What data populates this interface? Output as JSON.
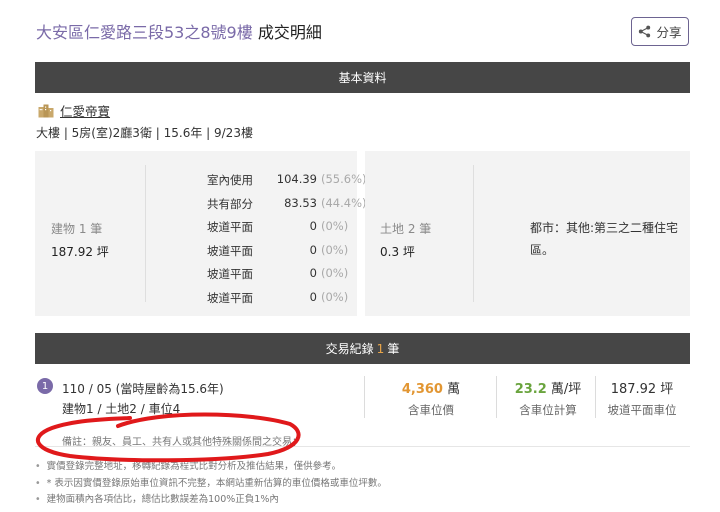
{
  "page": {
    "title_address": "大安區仁愛路三段53之8號9樓",
    "title_suffix": "成交明細",
    "share_label": "分享"
  },
  "basic": {
    "header": "基本資料",
    "community_name": "仁愛帝寶",
    "summary": "大樓 | 5房(室)2廳3衛 | 15.6年 | 9/23樓",
    "building": {
      "label": "建物 1 筆",
      "total": "187.92 坪",
      "rows": [
        {
          "label": "室內使用",
          "value": "104.39",
          "pct": "(55.6%)"
        },
        {
          "label": "共有部分",
          "value": "83.53",
          "pct": "(44.4%)"
        },
        {
          "label": "坡道平面",
          "value": "0",
          "pct": "(0%)"
        },
        {
          "label": "坡道平面",
          "value": "0",
          "pct": "(0%)"
        },
        {
          "label": "坡道平面",
          "value": "0",
          "pct": "(0%)"
        },
        {
          "label": "坡道平面",
          "value": "0",
          "pct": "(0%)"
        }
      ]
    },
    "land": {
      "label": "土地 2 筆",
      "total": "0.3 坪",
      "zoning": "都市：其他:第三之二種住宅區。"
    }
  },
  "transactions": {
    "header_prefix": "交易紀錄",
    "count": "1",
    "header_suffix": "筆",
    "records": [
      {
        "index": "1",
        "date": "110 / 05 (當時屋齡為15.6年)",
        "parts": "建物1 / 土地2 / 車位4",
        "price_value": "4,360",
        "price_unit": "萬",
        "price_caption": "含車位價",
        "unit_price_value": "23.2",
        "unit_price_unit": "萬/坪",
        "unit_price_caption": "含車位計算",
        "parking_area": "187.92 坪",
        "parking_caption": "坡道平面車位",
        "remark": "備註：親友、員工、共有人或其他特殊關係間之交易；"
      }
    ]
  },
  "notes": [
    "實價登錄完整地址，移轉紀錄為程式比對分析及推估結果，僅供參考。",
    "* 表示因實價登錄原始車位資訊不完整，本網站重新估算的車位價格或車位坪數。",
    "建物面積內各項估比，總估比數誤差為100%正負1%內"
  ],
  "colors": {
    "accent": "#7a6aa8",
    "bar": "#464646",
    "price": "#e29632",
    "unit_price": "#6aa43e",
    "annotation": "#e0191b"
  }
}
